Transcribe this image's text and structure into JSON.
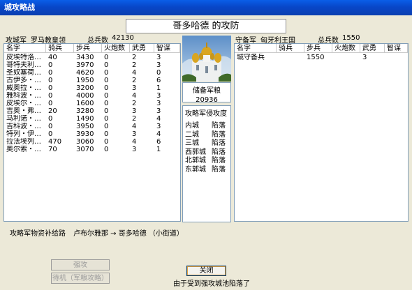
{
  "window": {
    "title": "城攻略战"
  },
  "banner": {
    "text": "哥多哈德 的攻防"
  },
  "attack": {
    "label": "攻城军",
    "leader": "罗马教皇领",
    "total_label": "总兵数",
    "total": "42130",
    "columns": [
      "名字",
      "骑兵",
      "步兵",
      "火炮数",
      "武勇",
      "智谋"
    ],
    "rows": [
      [
        "皮埃特洛…",
        "40",
        "3430",
        "0",
        "2",
        "3"
      ],
      [
        "哥特夫利…",
        "0",
        "3970",
        "0",
        "2",
        "3"
      ],
      [
        "圣奴塞荷…",
        "0",
        "4620",
        "0",
        "4",
        "0"
      ],
      [
        "古伊多・…",
        "0",
        "1950",
        "0",
        "2",
        "6"
      ],
      [
        "威奥拉・…",
        "0",
        "3200",
        "0",
        "3",
        "1"
      ],
      [
        "雅科波・…",
        "0",
        "4000",
        "0",
        "4",
        "3"
      ],
      [
        "皮埃尔・…",
        "0",
        "1600",
        "0",
        "2",
        "3"
      ],
      [
        "吉奥・弗…",
        "20",
        "3280",
        "0",
        "3",
        "3"
      ],
      [
        "马利诺・…",
        "0",
        "1490",
        "0",
        "2",
        "4"
      ],
      [
        "吉科波・…",
        "0",
        "3950",
        "0",
        "4",
        "3"
      ],
      [
        "特列・伊…",
        "0",
        "3930",
        "0",
        "3",
        "4"
      ],
      [
        "拉法埃列…",
        "470",
        "3060",
        "0",
        "4",
        "6"
      ],
      [
        "奥尔索・…",
        "70",
        "3070",
        "0",
        "3",
        "1"
      ]
    ]
  },
  "defense": {
    "label": "守备军",
    "leader": "匈牙利王国",
    "total_label": "总兵数",
    "total": "1550",
    "columns": [
      "名字",
      "骑兵",
      "步兵",
      "火炮数",
      "武勇",
      "智谋"
    ],
    "rows": [
      [
        "城守备兵",
        "",
        "1550",
        "",
        "3",
        ""
      ]
    ]
  },
  "reserve": {
    "label": "储备军粮",
    "value": "20936"
  },
  "siege_progress": {
    "title": "攻略军侵攻度",
    "items": [
      {
        "name": "内城",
        "status": "陷落"
      },
      {
        "name": "二城",
        "status": "陷落"
      },
      {
        "name": "三城",
        "status": "陷落"
      },
      {
        "name": "西郭城",
        "status": "陷落"
      },
      {
        "name": "北郭城",
        "status": "陷落"
      },
      {
        "name": "东郭城",
        "status": "陷落"
      }
    ]
  },
  "supply_route": {
    "label": "攻略军物资补给路",
    "text": "卢布尔雅那 → 哥多哈德 （小街道）"
  },
  "buttons": {
    "assault": "强攻",
    "wait": "待机（军粮攻略）",
    "close": "关闭"
  },
  "status_message": "由于受到强攻城池陷落了"
}
